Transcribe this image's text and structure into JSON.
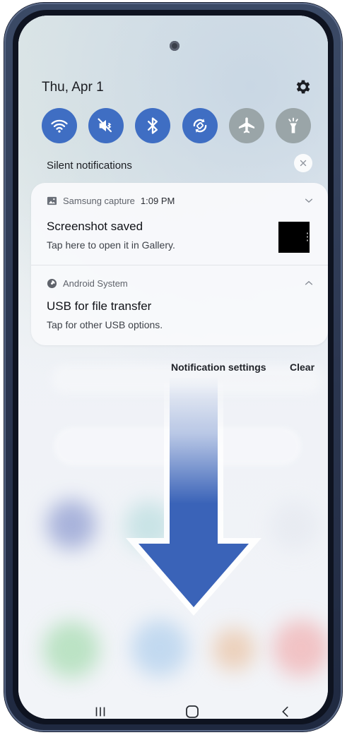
{
  "status": {
    "date": "Thu, Apr 1"
  },
  "quick_toggles": [
    {
      "name": "wifi-icon",
      "state": "on"
    },
    {
      "name": "mute-icon",
      "state": "on"
    },
    {
      "name": "bluetooth-icon",
      "state": "on"
    },
    {
      "name": "auto-rotate-icon",
      "state": "on"
    },
    {
      "name": "airplane-icon",
      "state": "off"
    },
    {
      "name": "flashlight-icon",
      "state": "off"
    }
  ],
  "silent_section": {
    "label": "Silent notifications"
  },
  "notifications": [
    {
      "app": "Samsung capture",
      "time": "1:09 PM",
      "title": "Screenshot saved",
      "body": "Tap here to open it in Gallery.",
      "expander": "chevron-down-icon"
    },
    {
      "app": "Android System",
      "title": "USB for file transfer",
      "body": "Tap for other USB options.",
      "expander": "chevron-up-icon"
    }
  ],
  "footer": {
    "settings_label": "Notification settings",
    "clear_label": "Clear"
  },
  "colors": {
    "toggle_on": "#3f6ec3",
    "toggle_off": "#9aa5a8",
    "arrow": "#3a63b8"
  }
}
